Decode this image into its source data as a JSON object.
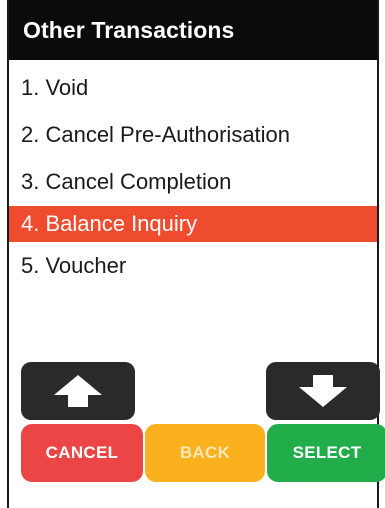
{
  "header": {
    "title": "Other Transactions"
  },
  "menu": {
    "items": [
      {
        "label": "1. Void"
      },
      {
        "label": "2. Cancel Pre-Authorisation"
      },
      {
        "label": "3. Cancel Completion"
      },
      {
        "label": "4. Balance Inquiry",
        "selected": true
      },
      {
        "label": "5. Voucher"
      }
    ]
  },
  "buttons": {
    "up_icon": "arrow-up-icon",
    "down_icon": "arrow-down-icon",
    "cancel_label": "CANCEL",
    "back_label": "BACK",
    "select_label": "SELECT"
  },
  "colors": {
    "header_bg": "#0b0b0b",
    "highlight": "#ef4b2e",
    "cancel": "#eb4545",
    "back": "#fbb01e",
    "select": "#22ad4b",
    "nav": "#2a2a2a"
  }
}
